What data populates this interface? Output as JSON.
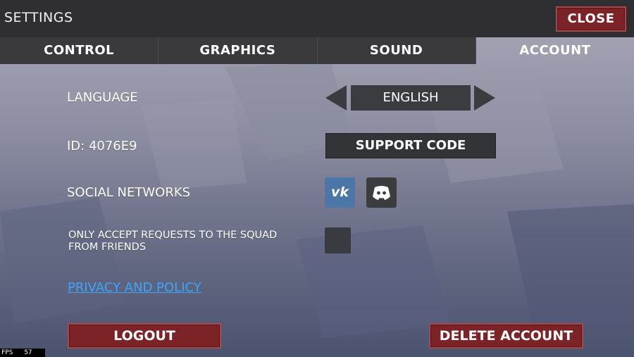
{
  "header": {
    "title": "SETTINGS",
    "close_label": "CLOSE"
  },
  "tabs": [
    {
      "label": "CONTROL",
      "active": false
    },
    {
      "label": "GRAPHICS",
      "active": false
    },
    {
      "label": "SOUND",
      "active": false
    },
    {
      "label": "ACCOUNT",
      "active": true
    }
  ],
  "account": {
    "language_label": "LANGUAGE",
    "language_value": "ENGLISH",
    "id_label": "ID: 4076E9",
    "support_code_label": "SUPPORT CODE",
    "social_label": "SOCIAL NETWORKS",
    "social_icons": [
      "vk-icon",
      "discord-icon"
    ],
    "squad_requests_label": "ONLY ACCEPT REQUESTS TO THE SQUAD FROM FRIENDS",
    "squad_requests_checked": false,
    "privacy_label": "PRIVACY AND POLICY",
    "logout_label": "LOGOUT",
    "delete_label": "DELETE ACCOUNT"
  },
  "fps": {
    "label": "FPS",
    "value": "57"
  },
  "colors": {
    "accent_red": "#7b2326",
    "link_blue": "#3aa6ff",
    "vk_blue": "#4a76a8",
    "panel_dark": "#3b3c40"
  }
}
